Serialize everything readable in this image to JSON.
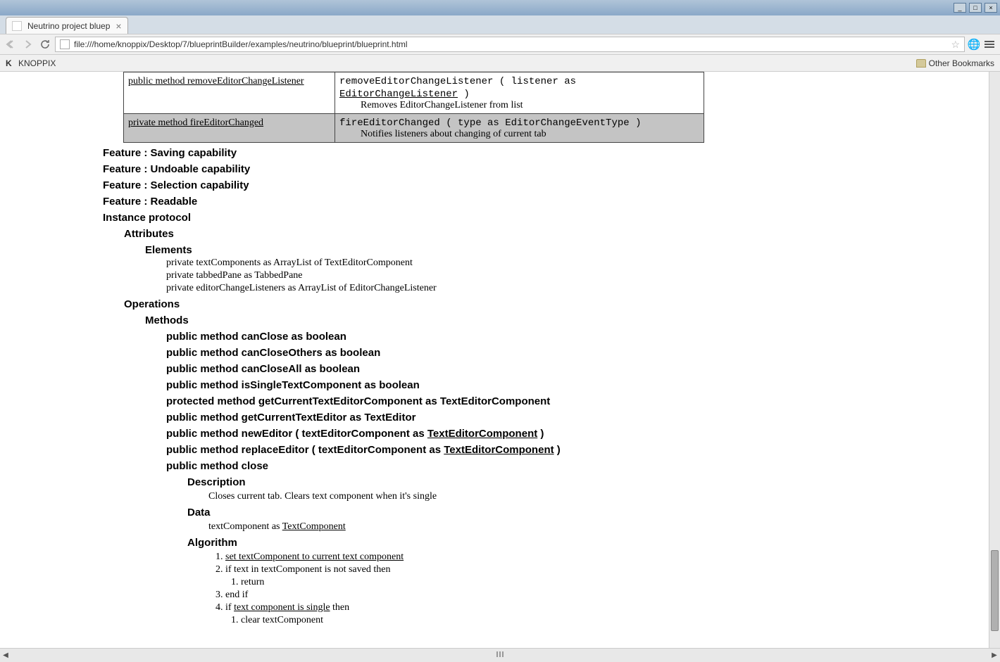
{
  "window": {
    "tab_title": "Neutrino project bluep",
    "url": "file:///home/knoppix/Desktop/7/blueprintBuilder/examples/neutrino/blueprint/blueprint.html"
  },
  "bookmarks": {
    "knoppix": "KNOPPIX",
    "other": "Other Bookmarks"
  },
  "table_rows": [
    {
      "gray": false,
      "link": "public method removeEditorChangeListener",
      "sig_pre": "removeEditorChangeListener ( listener as ",
      "sig_type": "EditorChangeListener",
      "sig_post": " )",
      "desc": "Removes EditorChangeListener from list"
    },
    {
      "gray": true,
      "link": "private method fireEditorChanged",
      "sig_pre": "fireEditorChanged ( type as EditorChangeEventType )",
      "sig_type": "",
      "sig_post": "",
      "desc": "Notifies listeners about changing of current tab"
    }
  ],
  "features": [
    "Feature : Saving capability",
    "Feature : Undoable capability",
    "Feature : Selection capability",
    "Feature : Readable"
  ],
  "instance_protocol": "Instance protocol",
  "attributes": "Attributes",
  "elements_h": "Elements",
  "elements": [
    "private textComponents as ArrayList of TextEditorComponent",
    "private tabbedPane as TabbedPane",
    "private editorChangeListeners as ArrayList of EditorChangeListener"
  ],
  "operations": "Operations",
  "methods_h": "Methods",
  "methods": [
    {
      "pre": "public method canClose as boolean",
      "type": "",
      "post": ""
    },
    {
      "pre": "public method canCloseOthers as boolean",
      "type": "",
      "post": ""
    },
    {
      "pre": "public method canCloseAll as boolean",
      "type": "",
      "post": ""
    },
    {
      "pre": "public method isSingleTextComponent as boolean",
      "type": "",
      "post": ""
    },
    {
      "pre": "protected method getCurrentTextEditorComponent as TextEditorComponent",
      "type": "",
      "post": ""
    },
    {
      "pre": "public method getCurrentTextEditor as TextEditor",
      "type": "",
      "post": ""
    },
    {
      "pre": "public method newEditor ( textEditorComponent as ",
      "type": "TextEditorComponent",
      "post": " )"
    },
    {
      "pre": "public method replaceEditor ( textEditorComponent as ",
      "type": "TextEditorComponent",
      "post": " )"
    },
    {
      "pre": "public method close",
      "type": "",
      "post": ""
    }
  ],
  "close_section": {
    "description_h": "Description",
    "description": "Closes current tab. Clears text component when it's single",
    "data_h": "Data",
    "data_pre": "textComponent as ",
    "data_type": "TextComponent",
    "algorithm_h": "Algorithm",
    "algo": {
      "s1": "set textComponent to current text component",
      "s2": "if text in textComponent is not saved then",
      "s2_1": "return",
      "s3": "end if",
      "s4_pre": "if ",
      "s4_link": "text component is single",
      "s4_post": " then",
      "s4_1": "clear textComponent"
    }
  }
}
